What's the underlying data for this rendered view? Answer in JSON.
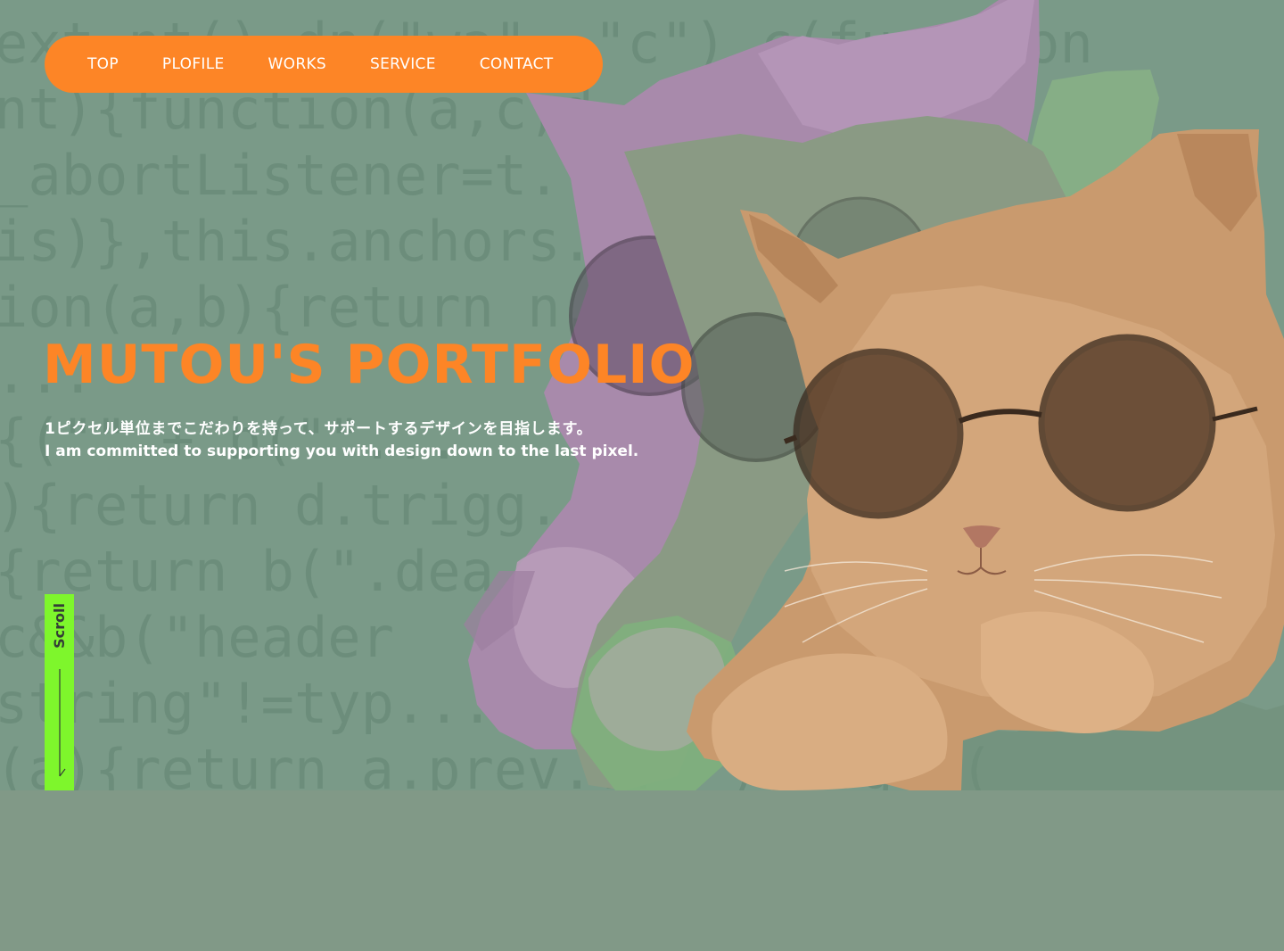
{
  "nav": {
    "items": [
      {
        "label": "TOP"
      },
      {
        "label": "PLOFILE"
      },
      {
        "label": "WORKS"
      },
      {
        "label": "SERVICE"
      },
      {
        "label": "CONTACT"
      }
    ]
  },
  "hero": {
    "title": "MUTOU'S PORTFOLIO",
    "subtitle_jp": "1ピクセル単位までこだわりを持って、サポートするデザインを目指します。",
    "subtitle_en": "I am committed to supporting you with design down to the last pixel.",
    "background_code": "ext,nt(),dn(\"wa\", \"c\"),c(function\nnt){function(a,c,d,e){\"select\"\n_abortListener=t...\nis)},this.anchors...\nion(a,b){return n...\n...\n{(\"\" + b(\"\"...\n){return d.trigg...\n{return b(\".dea...\nc&&b(\"header\nstring\"!=typ...\n(a){return a.prev...  ),b.get(",
    "accent_color": "#fd8526",
    "background_color": "#7a9a88"
  },
  "scroll": {
    "label": "Scroll",
    "color": "#7ef62c"
  },
  "images": [
    {
      "name": "cat-with-sunglasses",
      "description_icon": "cat-illustration"
    }
  ]
}
